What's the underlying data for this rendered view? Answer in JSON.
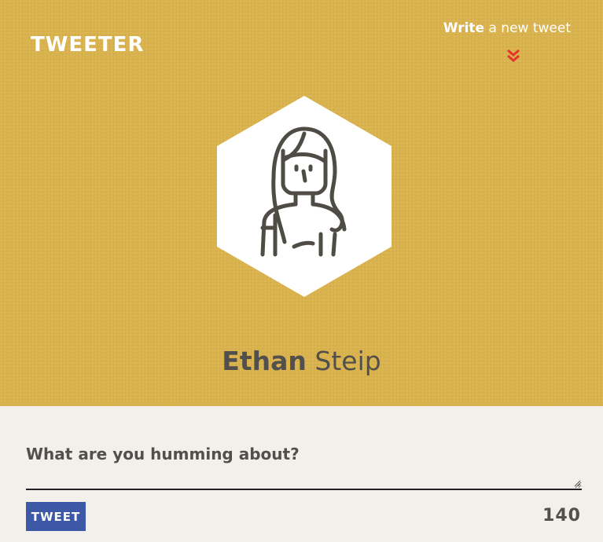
{
  "header": {
    "logo": "TWEETER",
    "write_link": {
      "strong": "Write",
      "rest": "a new tweet"
    },
    "chevron_icon": "double-chevron-down-icon"
  },
  "profile": {
    "avatar_icon": "person-avatar-icon",
    "first_name": "Ethan",
    "last_name": "Steip"
  },
  "compose": {
    "placeholder": "What are you humming about?",
    "value": "",
    "button_label": "TWEET",
    "char_count": "140"
  },
  "colors": {
    "hero_bg": "#d9b24c",
    "accent_red": "#e5352b",
    "button_blue": "#3d58a6",
    "text_dark": "#52504c",
    "panel_bg": "#f3f0ec"
  }
}
